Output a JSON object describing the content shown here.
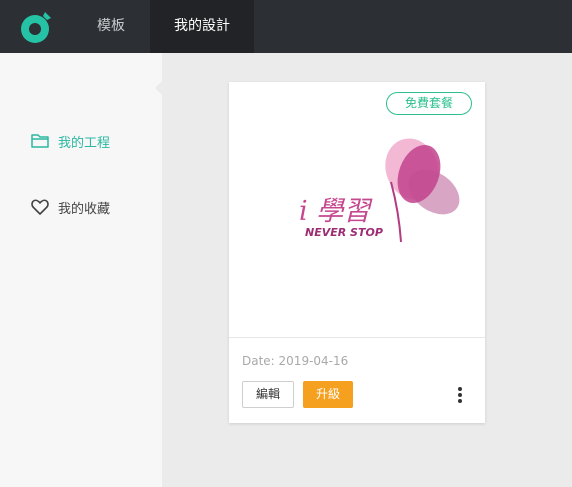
{
  "nav": {
    "tabs": [
      {
        "label": "模板"
      },
      {
        "label": "我的設計"
      }
    ],
    "active_tab": 1
  },
  "sidebar": {
    "items": [
      {
        "label": "我的工程",
        "icon": "folder-icon"
      },
      {
        "label": "我的收藏",
        "icon": "heart-icon"
      }
    ]
  },
  "card": {
    "badge": "免費套餐",
    "logo_text": "i 學習",
    "logo_subtext": "NEVER STOP",
    "date": "Date: 2019-04-16",
    "edit_label": "編輯",
    "upgrade_label": "升級"
  },
  "colors": {
    "topbar": "#2c2f33",
    "accent": "#2bb8a0",
    "badge": "#2bc08e",
    "upgrade": "#f5a01f",
    "logo_pink": "#c5488f"
  }
}
